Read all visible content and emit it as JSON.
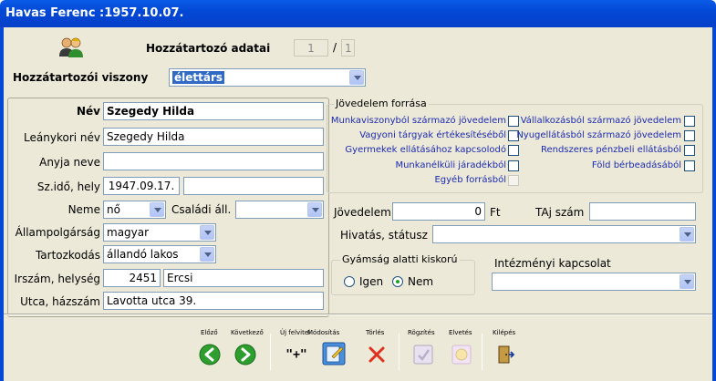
{
  "window": {
    "title": "Havas Ferenc :1957.10.07."
  },
  "header": {
    "title": "Hozzátartozó adatai",
    "counter_current": "1",
    "counter_separator": "/",
    "counter_total": "1"
  },
  "relation": {
    "label": "Hozzátartozói viszony",
    "value": "élettárs"
  },
  "person": {
    "name_label": "Név",
    "name_value": "Szegedy Hilda",
    "maiden_label": "Leánykori név",
    "maiden_value": "Szegedy Hilda",
    "mother_label": "Anyja neve",
    "mother_value": "",
    "birth_label": "Sz.idő, hely",
    "birth_date": "1947.09.17.",
    "birth_place": "",
    "sex_label": "Neme",
    "sex_value": "nő",
    "marital_label": "Családi áll.",
    "marital_value": "",
    "citizenship_label": "Állampolgárság",
    "citizenship_value": "magyar",
    "residence_label": "Tartozkodás",
    "residence_value": "állandó lakos",
    "zip_label": "Irszám, helység",
    "zip_value": "2451",
    "city_value": "Ercsi",
    "street_label": "Utca, házszám",
    "street_value": "Lavotta utca 39."
  },
  "income": {
    "group_title": "Jövedelem forrása",
    "left": [
      "Munkaviszonyból származó jövedelem",
      "Vagyoni tárgyak értékesítéséből",
      "Gyermekek ellátásához kapcsolodó",
      "Munkanélküli járadékból",
      "Egyéb forrásból"
    ],
    "right": [
      "Vállalkozásból származó jövedelem",
      "Nyugellátásból származó jövedelem",
      "Rendszeres pénzbeli ellátásból",
      "Föld bérbeadásából"
    ],
    "amount_label": "Jövedelem",
    "amount_value": "0",
    "currency": "Ft",
    "taj_label": "TAj szám",
    "taj_value": ""
  },
  "profession": {
    "label": "Hivatás, státusz",
    "value": ""
  },
  "guardianship": {
    "title": "Gyámság alatti kiskorú",
    "yes": "Igen",
    "no": "Nem"
  },
  "institution": {
    "label": "Intézményi kapcsolat",
    "value": ""
  },
  "toolbar": {
    "prev": "Előző",
    "next": "Következő",
    "new": "Új felvitel",
    "edit": "Módosítás",
    "delete": "Törlés",
    "save": "Rögzítés",
    "discard": "Elvetés",
    "exit": "Kilépés",
    "new_glyph": "\"+\""
  },
  "colors": {
    "title_bar": "#0348d6",
    "client": "#ece9d8",
    "link_label": "#1b2ab0"
  }
}
